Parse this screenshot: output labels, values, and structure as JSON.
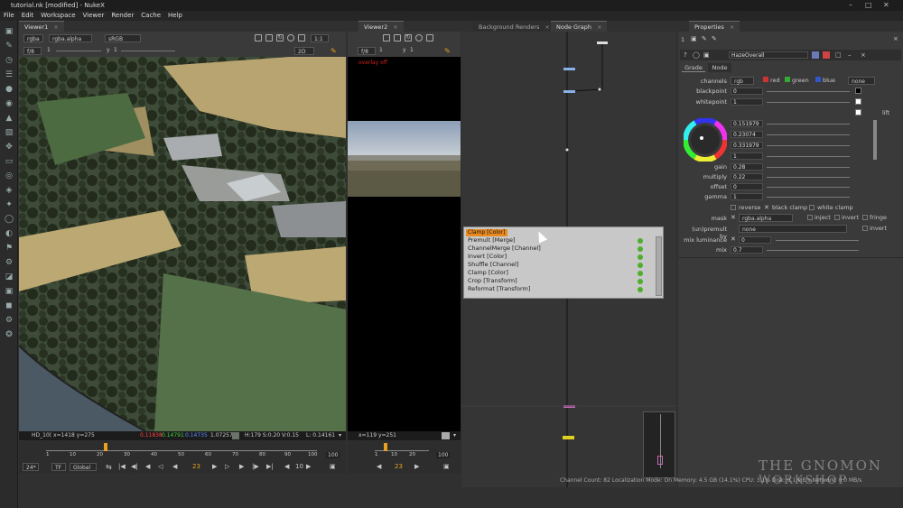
{
  "window": {
    "title": "tutorial.nk [modified] - NukeX"
  },
  "menubar": {
    "items": [
      "File",
      "Edit",
      "Workspace",
      "Viewer",
      "Render",
      "Cache",
      "Help"
    ]
  },
  "viewer1": {
    "tab": "Viewer1",
    "channels": "rgba",
    "alpha": "rgba.alpha",
    "colorspace": "sRGB",
    "zoom": "1:1",
    "fstop": "f/8",
    "frame_label": "1",
    "y_label": "1",
    "mode": "2D",
    "pixel_info": "HD_10( x=1418 y=275",
    "r": "0.11838",
    "g": "0.14791",
    "b": "0.14735",
    "a": "1.07257",
    "hsv": "H:179 S:0.20 V:0.15",
    "lum": "L: 0.14161",
    "timeline_ticks": [
      "1",
      "10",
      "20",
      "30",
      "40",
      "50",
      "60",
      "70",
      "80",
      "90",
      "100"
    ],
    "timeline_end": "100",
    "fps": "24*",
    "tf": "TF",
    "global": "Global",
    "current_frame": "23",
    "skip": "10"
  },
  "viewer2": {
    "tab": "Viewer2",
    "fstop": "f/8",
    "frame_label": "1",
    "y_label": "1",
    "overlay_text": "overlay off",
    "pixel_info": "x=119 y=251",
    "timeline_ticks": [
      "1",
      "10",
      "20"
    ],
    "timeline_end": "100",
    "current_frame": "23"
  },
  "nodegraph": {
    "tabs": [
      "Background Renders",
      "Node Graph"
    ],
    "menu_header": "Clamp [Color]",
    "menu_items": [
      "Premult [Merge]",
      "ChannelMerge [Channel]",
      "Invert [Color]",
      "Shuffle [Channel]",
      "Clamp [Color]",
      "Crop [Transform]",
      "Reformat [Transform]"
    ]
  },
  "properties": {
    "tab": "Properties",
    "count": "1",
    "node_name": "HazeOverall",
    "subtabs": [
      "Grade",
      "Node"
    ],
    "channels_label": "channels",
    "channels_value": "rgb",
    "ch_red": "red",
    "ch_green": "green",
    "ch_blue": "blue",
    "ch_none": "none",
    "blackpoint_label": "blackpoint",
    "blackpoint": "0",
    "whitepoint_label": "whitepoint",
    "whitepoint": "1",
    "lift_label": "lift",
    "color_values": [
      "0.151979",
      "0.23074",
      "0.331979",
      "1"
    ],
    "gain_label": "gain",
    "gain": "0.28",
    "multiply_label": "multiply",
    "multiply": "0.22",
    "offset_label": "offset",
    "offset": "0",
    "gamma_label": "gamma",
    "gamma": "1",
    "reverse": "reverse",
    "black_clamp": "black clamp",
    "white_clamp": "white clamp",
    "mask_label": "mask",
    "mask_value": "rgba.alpha",
    "inject": "inject",
    "invert": "invert",
    "fringe": "fringe",
    "unpremult_label": "(un)premult by",
    "unpremult_value": "none",
    "invert2": "invert",
    "mixlum_label": "mix luminance",
    "mixlum": "0",
    "mix_label": "mix",
    "mix": "0.7",
    "slider_ticks": [
      "0",
      "0.1",
      "0.2",
      "0.3",
      "0.4",
      "0.5",
      "0.6",
      "0.7",
      "0.8",
      "0.9",
      "1"
    ]
  },
  "statusbar": {
    "text": "Channel Count: 82  Localization Mode: On  Memory: 4.5 GB (14.1%)  CPU: 3.1%  Disk: 0.1 MB/s  Network: 0.0 MB/s"
  },
  "watermark": {
    "line1": "THE GNOMON",
    "line2": "WORKSHOP"
  }
}
